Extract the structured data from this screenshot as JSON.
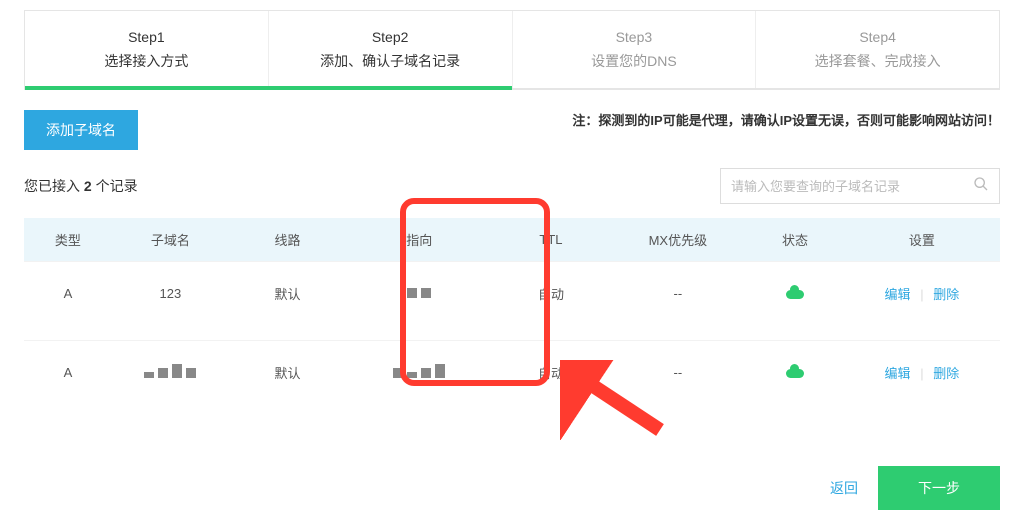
{
  "steps": [
    {
      "num": "Step1",
      "label": "选择接入方式",
      "active": true
    },
    {
      "num": "Step2",
      "label": "添加、确认子域名记录",
      "active": true
    },
    {
      "num": "Step3",
      "label": "设置您的DNS",
      "active": false
    },
    {
      "num": "Step4",
      "label": "选择套餐、完成接入",
      "active": false
    }
  ],
  "buttons": {
    "add_subdomain": "添加子域名",
    "back": "返回",
    "next": "下一步"
  },
  "warning": "注：探测到的IP可能是代理，请确认IP设置无误，否则可能影响网站访问！",
  "count_prefix": "您已接入 ",
  "count_value": "2",
  "count_suffix": " 个记录",
  "search": {
    "placeholder": "请输入您要查询的子域名记录"
  },
  "columns": {
    "type": "类型",
    "subdomain": "子域名",
    "line": "线路",
    "target": "指向",
    "ttl": "TTL",
    "mx": "MX优先级",
    "status": "状态",
    "actions": "设置"
  },
  "rows": [
    {
      "type": "A",
      "subdomain": "123",
      "line": "默认",
      "target": "",
      "ttl": "自动",
      "mx": "--",
      "status": "ok",
      "edit": "编辑",
      "delete": "删除"
    },
    {
      "type": "A",
      "subdomain": "",
      "line": "默认",
      "target": "",
      "ttl": "自动",
      "mx": "--",
      "status": "ok",
      "edit": "编辑",
      "delete": "删除"
    }
  ]
}
